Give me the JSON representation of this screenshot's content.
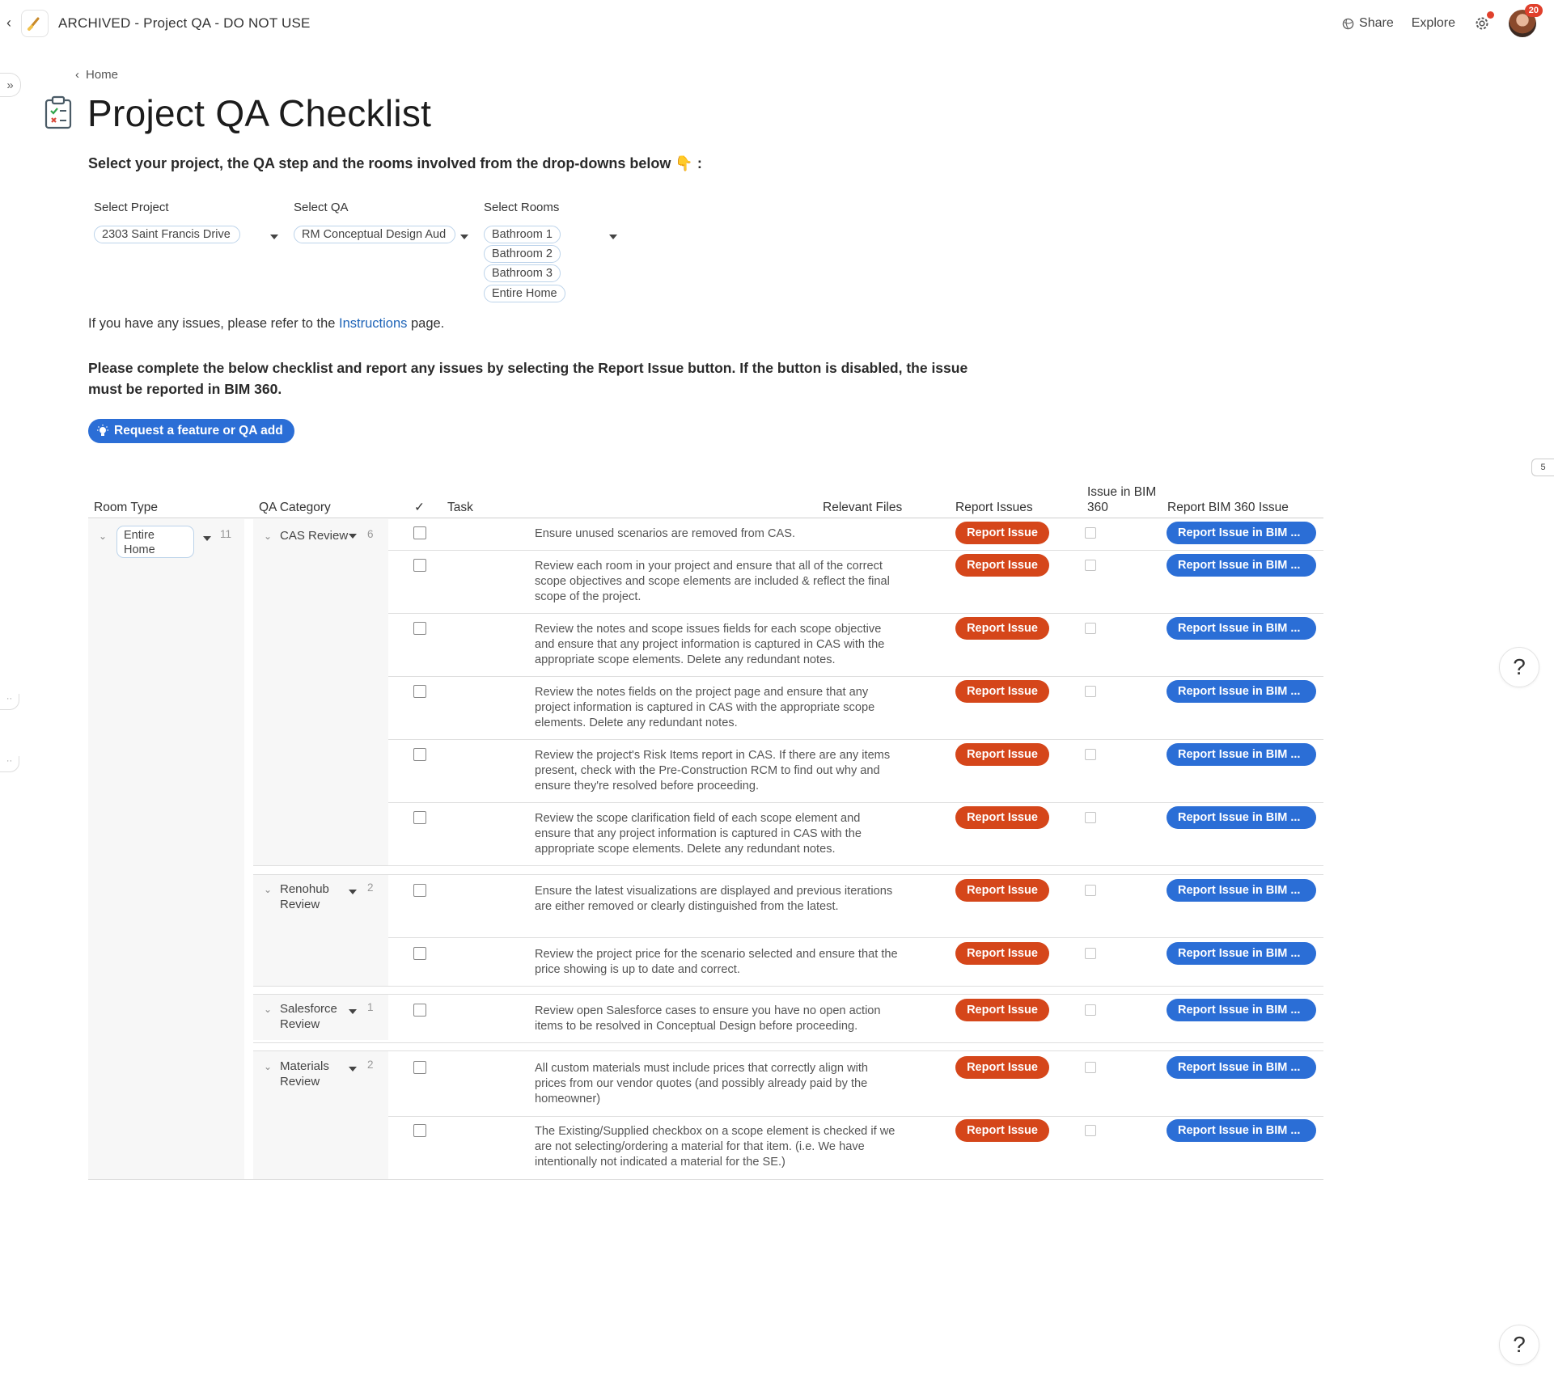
{
  "header": {
    "title": "ARCHIVED - Project QA - DO NOT USE",
    "share_label": "Share",
    "explore_label": "Explore",
    "notification_count": "20",
    "right_tab_count": "5"
  },
  "breadcrumb": {
    "home": "Home"
  },
  "page": {
    "title": "Project QA Checklist",
    "intro": "Select your project, the QA step and the rooms involved from the drop-downs below 👇 :",
    "info_prefix": "If you have any issues, please refer to the ",
    "info_link": "Instructions",
    "info_suffix": " page.",
    "bold_paragraph": "Please complete the below checklist and report any issues by selecting the Report Issue button. If the button is disabled, the issue must be reported in BIM 360.",
    "request_button": "Request a feature or QA add"
  },
  "selectors": {
    "project_label": "Select Project",
    "project_value": "2303 Saint Francis Drive",
    "qa_label": "Select QA",
    "qa_value": "RM Conceptual Design Aud",
    "rooms_label": "Select Rooms",
    "rooms": [
      "Bathroom 1",
      "Bathroom 2",
      "Bathroom 3",
      "Entire Home"
    ]
  },
  "table": {
    "headers": {
      "room_type": "Room Type",
      "qa_category": "QA Category",
      "check": "✓",
      "task": "Task",
      "relevant_files": "Relevant Files",
      "report_issues": "Report Issues",
      "issue_in_bim": "Issue in BIM 360",
      "report_bim": "Report BIM 360 Issue"
    },
    "room_group": {
      "label": "Entire Home",
      "count": "11"
    },
    "report_label": "Report Issue",
    "bim_label": "Report Issue in BIM ...",
    "categories": [
      {
        "label": "CAS Review",
        "count": "6"
      },
      {
        "label": "Renohub Review",
        "count": "2"
      },
      {
        "label": "Salesforce Review",
        "count": "1"
      },
      {
        "label": "Materials Review",
        "count": "2"
      }
    ],
    "tasks": [
      "Ensure unused scenarios are removed from CAS.",
      "Review each room in your project and ensure that all of the correct scope objectives and scope elements are included & reflect the final scope of the project.",
      "Review the notes and scope issues fields for each scope objective and ensure that any project information is captured in CAS with the appropriate scope elements. Delete any redundant notes.",
      "Review the notes fields on the project page and ensure that any project information is captured in CAS with the appropriate scope elements. Delete any redundant notes.",
      "Review the project's Risk Items report in CAS. If there are any items present, check with the Pre-Construction RCM to find out why and ensure they're resolved before proceeding.",
      "Review the scope clarification field of each scope element and ensure that any project information is captured in CAS with the appropriate scope elements. Delete any redundant notes.",
      "Ensure the latest visualizations are displayed and previous iterations are either removed or clearly distinguished from the latest.",
      "Review the project price for the scenario selected and ensure that the price showing is up to date and correct.",
      "Review open Salesforce cases to ensure you have no open action items to be resolved in Conceptual Design before proceeding.",
      "All custom materials must include prices that correctly align with prices from our vendor quotes (and possibly already paid by the homeowner)",
      "The Existing/Supplied checkbox on a scope element is checked if we are not selecting/ordering a material for that item. (i.e. We have intentionally not indicated a material for the SE.)"
    ]
  },
  "help": {
    "label": "?"
  },
  "colors": {
    "report": "#d5461a",
    "primary": "#2b6ed6",
    "link": "#1d63b7"
  }
}
